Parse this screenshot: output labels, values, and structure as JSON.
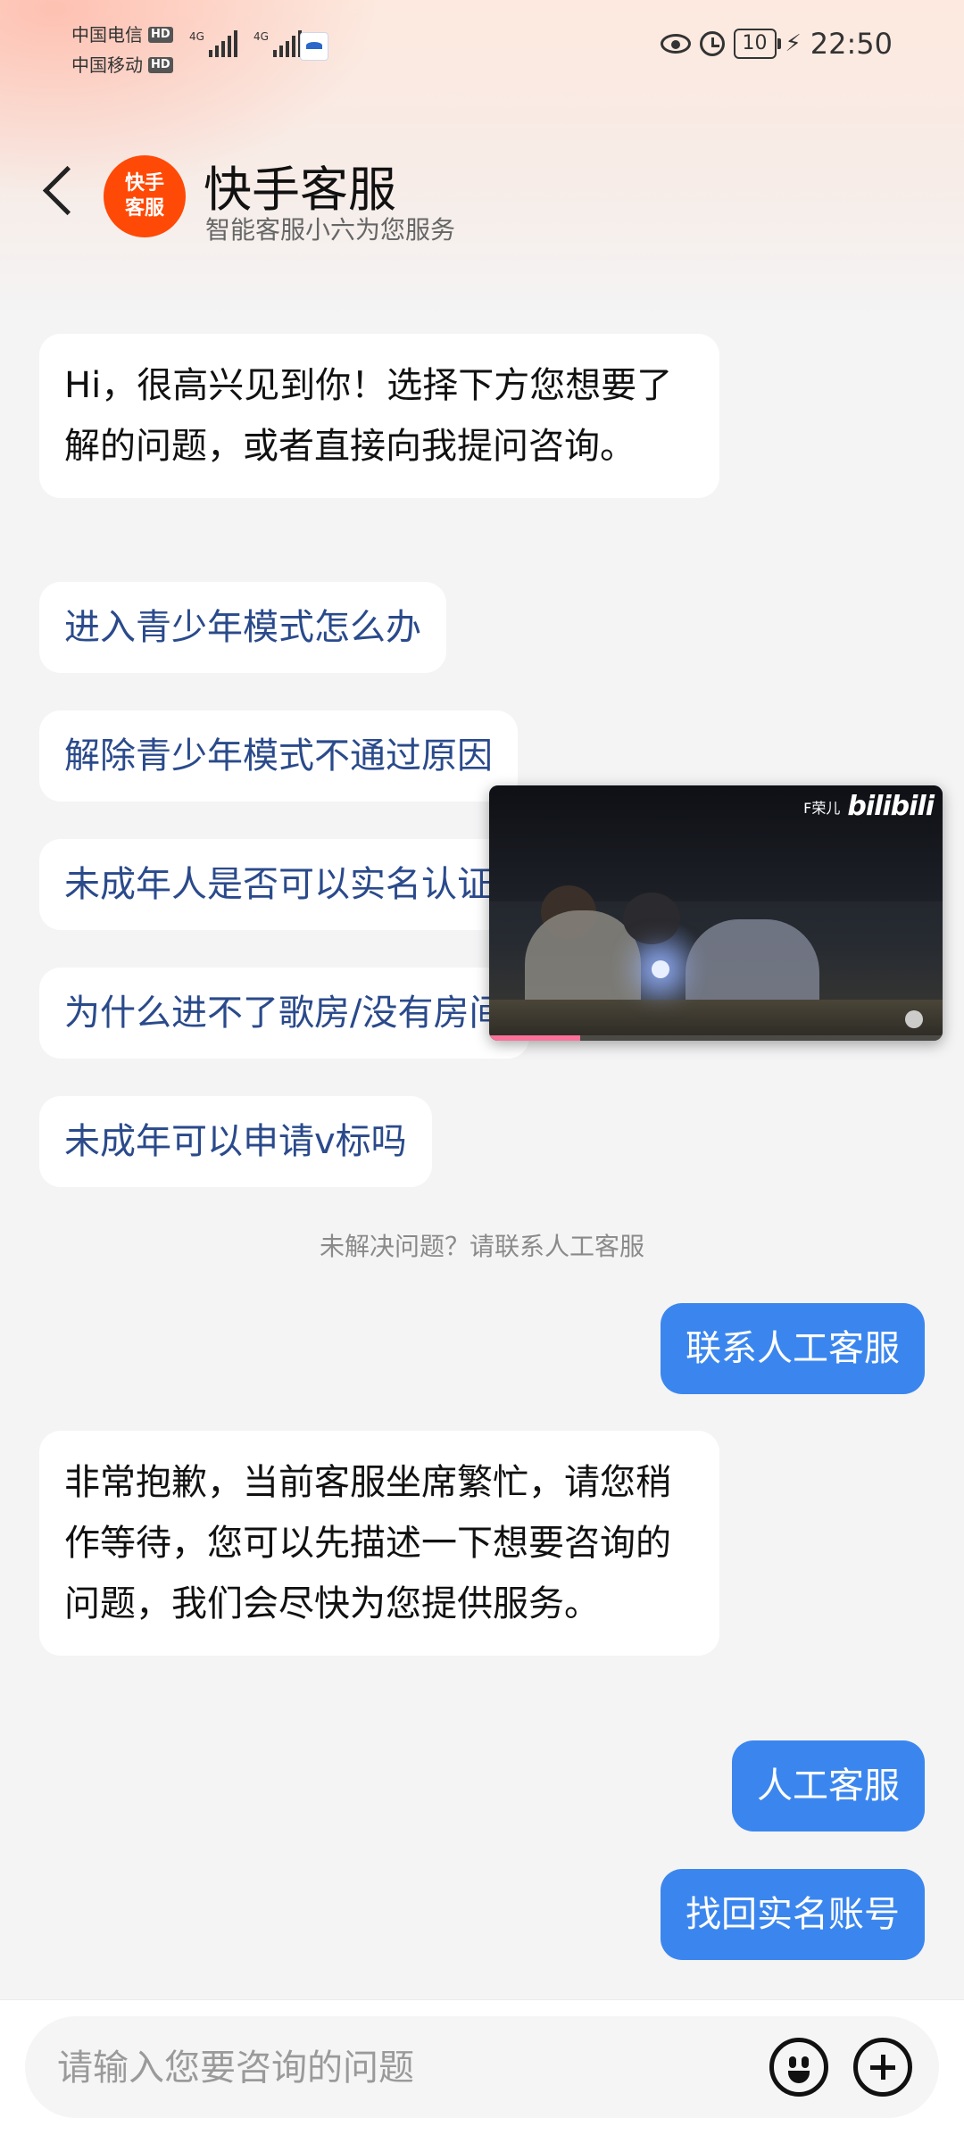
{
  "status_bar": {
    "carrier1": "中国电信",
    "carrier2": "中国移动",
    "hd": "HD",
    "net1": "4G",
    "net2": "4G",
    "battery": "10",
    "time": "22:50"
  },
  "header": {
    "avatar_text_1": "快手",
    "avatar_text_2": "客服",
    "title": "快手客服",
    "subtitle": "智能客服小六为您服务"
  },
  "chat": {
    "greeting": "Hi，很高兴见到你！选择下方您想要了解的问题，或者直接向我提问咨询。",
    "options": [
      "进入青少年模式怎么办",
      "解除青少年模式不通过原因",
      "未成年人是否可以实名认证",
      "为什么进不了歌房/没有房间",
      "未成年可以申请v标吗"
    ],
    "notice": "未解决问题？请联系人工客服",
    "user_msg_1": "联系人工客服",
    "agent_reply": "非常抱歉，当前客服坐席繁忙，请您稍作等待，您可以先描述一下想要咨询的问题，我们会尽快为您提供服务。",
    "user_msg_2": "人工客服",
    "user_msg_3": "找回实名账号"
  },
  "video_overlay": {
    "watermark_text": "F荣儿",
    "brand": "bilibili",
    "progress_fraction": 0.2
  },
  "input": {
    "placeholder": "请输入您要咨询的问题"
  },
  "colors": {
    "accent": "#3b86ee",
    "avatar": "#ff4906",
    "option_text": "#2a4a8b"
  }
}
